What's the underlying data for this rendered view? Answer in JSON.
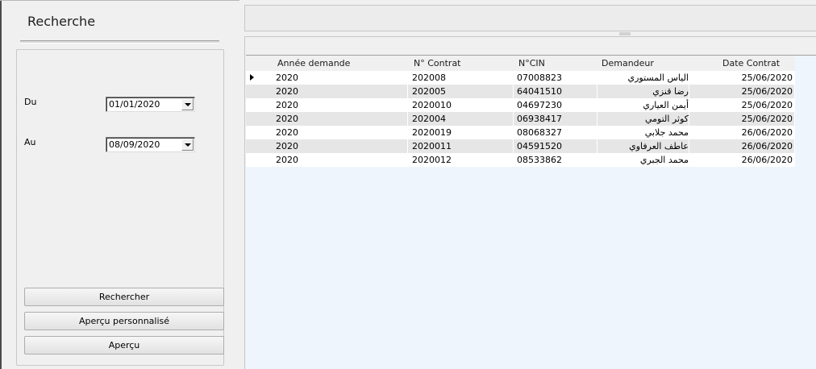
{
  "search_panel": {
    "title": "Recherche",
    "from_label": "Du",
    "from_value": "01/01/2020",
    "to_label": "Au",
    "to_value": "08/09/2020",
    "buttons": {
      "search": "Rechercher",
      "custom_preview": "Aperçu personnalisé",
      "preview": "Aperçu"
    }
  },
  "grid": {
    "columns": [
      "Année demande",
      "N° Contrat",
      "N°CIN",
      "Demandeur",
      "Date Contrat"
    ],
    "rows": [
      {
        "annee": "2020",
        "contrat": "202008",
        "cin": "07008823",
        "demandeur": "الياس المستوري",
        "date": "25/06/2020"
      },
      {
        "annee": "2020",
        "contrat": "202005",
        "cin": "64041510",
        "demandeur": "رضا قنزي",
        "date": "25/06/2020"
      },
      {
        "annee": "2020",
        "contrat": "2020010",
        "cin": "04697230",
        "demandeur": "أيمن العياري",
        "date": "25/06/2020"
      },
      {
        "annee": "2020",
        "contrat": "202004",
        "cin": "06938417",
        "demandeur": "كوثر التومي",
        "date": "25/06/2020"
      },
      {
        "annee": "2020",
        "contrat": "2020019",
        "cin": "08068327",
        "demandeur": "محمد جلابي",
        "date": "26/06/2020"
      },
      {
        "annee": "2020",
        "contrat": "2020011",
        "cin": "04591520",
        "demandeur": "عاطف العرفاوي",
        "date": "26/06/2020"
      },
      {
        "annee": "2020",
        "contrat": "2020012",
        "cin": "08533862",
        "demandeur": "محمد الجبري",
        "date": "26/06/2020"
      }
    ],
    "current_row": 0
  }
}
